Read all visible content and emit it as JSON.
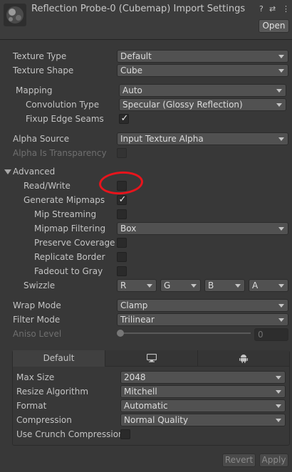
{
  "header": {
    "title": "Reflection Probe-0 (Cubemap) Import Settings",
    "help_glyph": "?",
    "settings_glyph": "⇄",
    "menu_glyph": "⋮",
    "open_label": "Open"
  },
  "texture": {
    "type_label": "Texture Type",
    "type_value": "Default",
    "shape_label": "Texture Shape",
    "shape_value": "Cube"
  },
  "mapping": {
    "label": "Mapping",
    "value": "Auto",
    "convolution_label": "Convolution Type",
    "convolution_value": "Specular (Glossy Reflection)",
    "fixup_label": "Fixup Edge Seams",
    "fixup_checked": true
  },
  "alpha": {
    "source_label": "Alpha Source",
    "source_value": "Input Texture Alpha",
    "transparency_label": "Alpha Is Transparency",
    "transparency_checked": false
  },
  "advanced": {
    "label": "Advanced",
    "read_write_label": "Read/Write",
    "read_write_checked": false,
    "gen_mip_label": "Generate Mipmaps",
    "gen_mip_checked": true,
    "mip_stream_label": "Mip Streaming",
    "mip_filter_label": "Mipmap Filtering",
    "mip_filter_value": "Box",
    "preserve_label": "Preserve Coverage",
    "replicate_label": "Replicate Border",
    "fadeout_label": "Fadeout to Gray",
    "swizzle_label": "Swizzle",
    "swizzle": [
      "R",
      "G",
      "B",
      "A"
    ]
  },
  "wrap": {
    "wrap_label": "Wrap Mode",
    "wrap_value": "Clamp",
    "filter_label": "Filter Mode",
    "filter_value": "Trilinear",
    "aniso_label": "Aniso Level",
    "aniso_value": "0"
  },
  "platform": {
    "tab_default": "Default",
    "tab_standalone_icon": "monitor-icon",
    "tab_android_icon": "android-icon",
    "max_size_label": "Max Size",
    "max_size_value": "2048",
    "resize_label": "Resize Algorithm",
    "resize_value": "Mitchell",
    "format_label": "Format",
    "format_value": "Automatic",
    "compression_label": "Compression",
    "compression_value": "Normal Quality",
    "crunch_label": "Use Crunch Compression",
    "crunch_checked": false
  },
  "footer": {
    "revert_label": "Revert",
    "apply_label": "Apply"
  },
  "colors": {
    "background": "#383838",
    "dropdown": "#515151",
    "annotation_circle": "#e8141c"
  }
}
